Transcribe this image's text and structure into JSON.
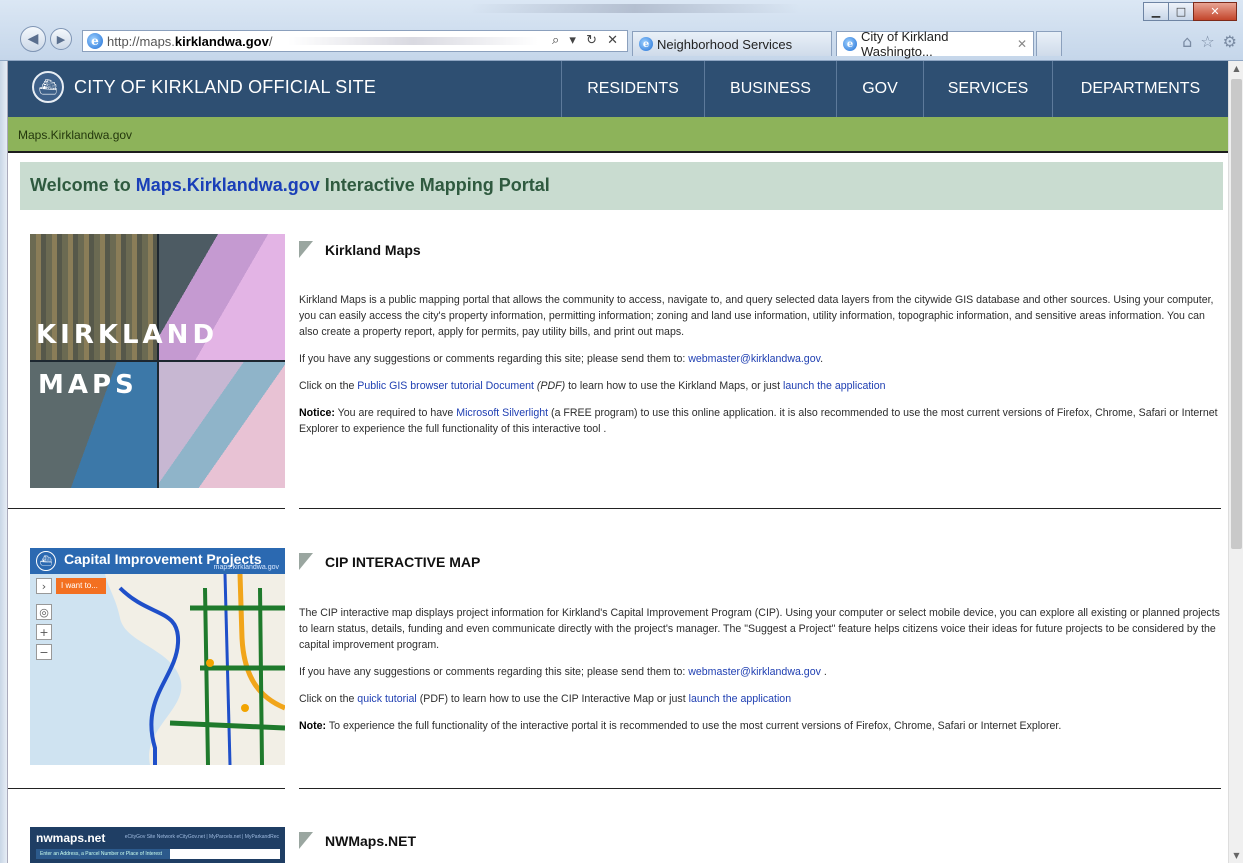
{
  "browser": {
    "url_prefix": "http://maps.",
    "url_domain": "kirklandwa.gov",
    "url_suffix": "/",
    "address_tools": "⌕ ▾ ↻ ✕",
    "tabs": [
      {
        "label": "Neighborhood Services",
        "active": false
      },
      {
        "label": "City of Kirkland Washingto...",
        "active": true
      }
    ],
    "tab_close": "✕",
    "window_buttons": {
      "minimize": "▁",
      "maximize": "□",
      "close": "✕"
    }
  },
  "site": {
    "title": "CITY OF KIRKLAND OFFICIAL SITE",
    "nav": [
      "RESIDENTS",
      "BUSINESS",
      "GOV",
      "SERVICES",
      "DEPARTMENTS"
    ],
    "breadcrumb": "Maps.Kirklandwa.gov",
    "welcome": {
      "prefix": "Welcome to ",
      "link": "Maps.Kirklandwa.gov",
      "suffix": " Interactive Mapping Portal"
    }
  },
  "sections": [
    {
      "title": "Kirkland Maps",
      "thumb_words": [
        "KIRKLAND",
        "MAPS"
      ],
      "description": "Kirkland Maps is a public mapping portal that allows the community to access, navigate to, and query selected data layers from the citywide GIS database and other sources. Using your computer, you can easily access the city's property information, permitting information; zoning and land use information, utility information, topographic information, and sensitive areas information. You can also create a property report, apply for permits, pay utility bills, and print out maps.",
      "contact_text": "If you have any suggestions or comments regarding this site; please send them to: ",
      "contact_email": "webmaster@kirklandwa.gov",
      "contact_end": ".",
      "tutorial_pre": "Click on the ",
      "tutorial_link": "Public GIS browser tutorial Document",
      "tutorial_pdf": " (PDF)",
      "tutorial_mid": " to learn how to use the Kirkland Maps, or just ",
      "launch_link": "launch the application",
      "notice_label": "Notice:",
      "notice_pre": " You are required to have ",
      "notice_link": "Microsoft Silverlight",
      "notice_post": " (a FREE program) to use this online application. it is also recommended to use the most current versions of Firefox, Chrome, Safari or Internet Explorer to experience the full functionality of this interactive tool ."
    },
    {
      "title": "CIP INTERACTIVE MAP",
      "thumb_title": "Capital Improvement Projects",
      "thumb_subtitle": "maps.kirklandwa.gov",
      "thumb_button": "I want to...",
      "description": "The CIP interactive map  displays project information for Kirkland's Capital Improvement Program (CIP). Using your computer or select mobile device, you can explore all existing or planned projects to learn status, details, funding and even communicate directly with the project's manager.  The \"Suggest a Project\" feature helps citizens voice their ideas for future projects to be considered by the capital improvement program.",
      "contact_text": "If you have any suggestions or comments regarding this site; please send them to: ",
      "contact_email": "webmaster@kirklandwa.gov",
      "contact_end": " .",
      "tutorial_pre": "Click on the ",
      "tutorial_link": "quick tutorial",
      "tutorial_mid": " (PDF) to learn how to use the CIP Interactive Map or just ",
      "launch_link": "launch the application",
      "note_label": "Note:",
      "note_text": " To experience the full functionality of the interactive portal it is recommended to use the most current versions of Firefox, Chrome, Safari or Internet Explorer."
    },
    {
      "title": "NWMaps.NET",
      "thumb_brand": "nwmaps.net",
      "thumb_links": "eCityGov Site Network  eCityGov.net | MyParcels.net | MyParkandRec",
      "thumb_search": "Enter an Address, a Parcel Number or Place of Interest"
    }
  ]
}
